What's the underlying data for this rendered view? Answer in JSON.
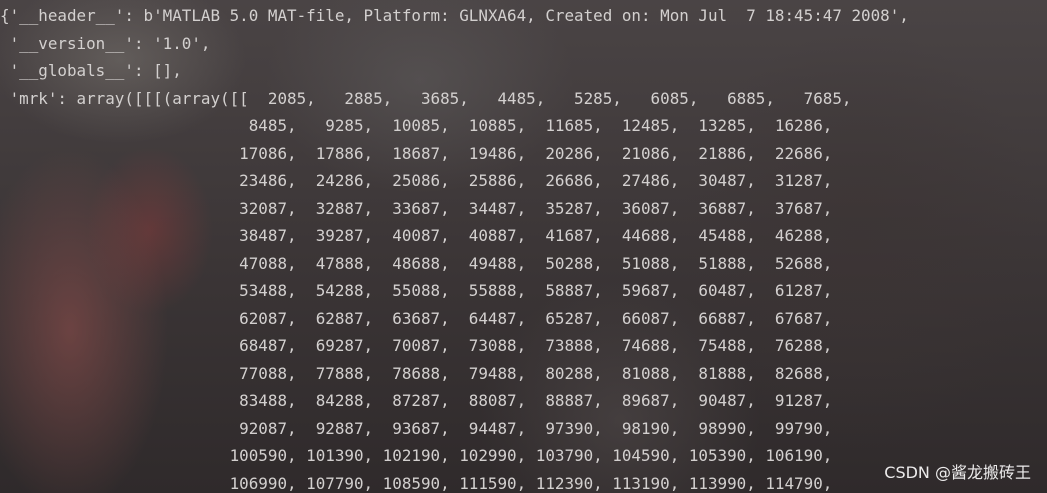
{
  "watermark": "CSDN @酱龙搬砖王",
  "output_lines": [
    "{'__header__': b'MATLAB 5.0 MAT-file, Platform: GLNXA64, Created on: Mon Jul  7 18:45:47 2008',",
    " '__version__': '1.0',",
    " '__globals__': [],",
    " 'mrk': array([[[(array([[  2085,   2885,   3685,   4485,   5285,   6085,   6885,   7685,",
    "                          8485,   9285,  10085,  10885,  11685,  12485,  13285,  16286,",
    "                         17086,  17886,  18687,  19486,  20286,  21086,  21886,  22686,",
    "                         23486,  24286,  25086,  25886,  26686,  27486,  30487,  31287,",
    "                         32087,  32887,  33687,  34487,  35287,  36087,  36887,  37687,",
    "                         38487,  39287,  40087,  40887,  41687,  44688,  45488,  46288,",
    "                         47088,  47888,  48688,  49488,  50288,  51088,  51888,  52688,",
    "                         53488,  54288,  55088,  55888,  58887,  59687,  60487,  61287,",
    "                         62087,  62887,  63687,  64487,  65287,  66087,  66887,  67687,",
    "                         68487,  69287,  70087,  73088,  73888,  74688,  75488,  76288,",
    "                         77088,  77888,  78688,  79488,  80288,  81088,  81888,  82688,",
    "                         83488,  84288,  87287,  88087,  88887,  89687,  90487,  91287,",
    "                         92087,  92887,  93687,  94487,  97390,  98190,  98990,  99790,",
    "                        100590, 101390, 102190, 102990, 103790, 104590, 105390, 106190,",
    "                        106990, 107790, 108590, 111590, 112390, 113190, 113990, 114790,"
  ]
}
